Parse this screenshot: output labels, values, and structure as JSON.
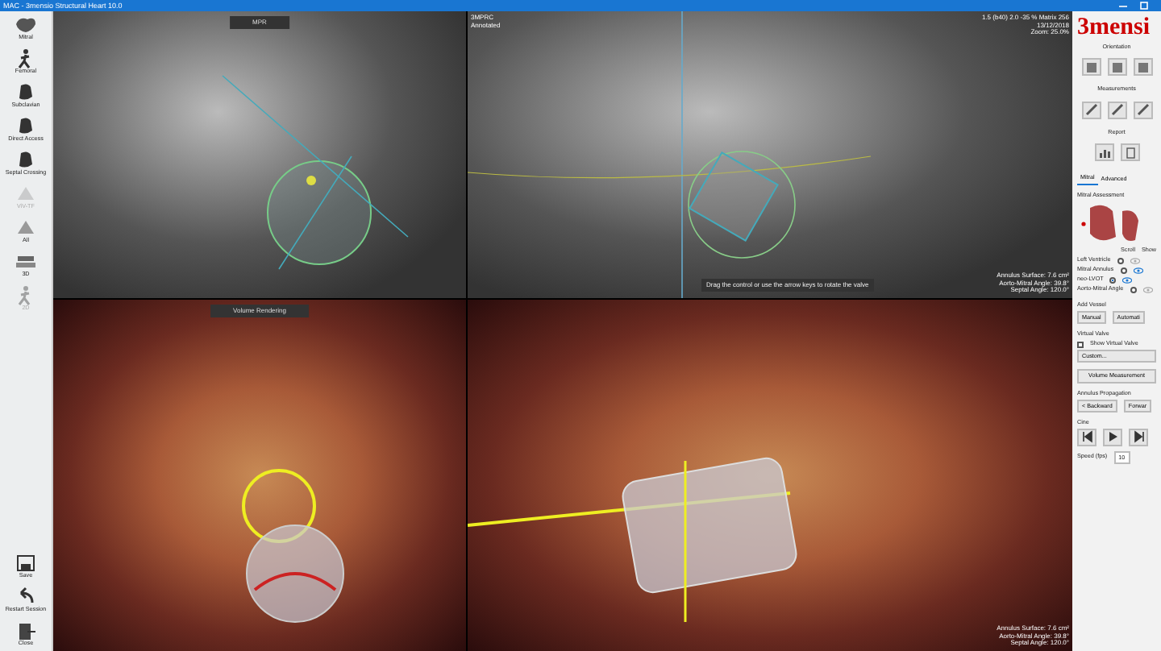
{
  "window": {
    "title": "MAC - 3mensio Structural Heart 10.0"
  },
  "sidebar": {
    "items": [
      {
        "label": "Mitral",
        "kind": "heart",
        "disabled": false
      },
      {
        "label": "Femoral",
        "kind": "walker",
        "disabled": false
      },
      {
        "label": "Subclavian",
        "kind": "torso",
        "disabled": false
      },
      {
        "label": "Direct Access",
        "kind": "torso",
        "disabled": false
      },
      {
        "label": "Septal Crossing",
        "kind": "torso",
        "disabled": false
      },
      {
        "label": "ViV-TF",
        "kind": "valve",
        "disabled": true
      },
      {
        "label": "All",
        "kind": "valve",
        "disabled": false
      },
      {
        "label": "3D",
        "kind": "stack",
        "disabled": false
      },
      {
        "label": "2D",
        "kind": "walker",
        "disabled": true
      }
    ],
    "bottom_items": [
      {
        "label": "Save",
        "kind": "save"
      },
      {
        "label": "Restart Session",
        "kind": "undo"
      },
      {
        "label": "Close",
        "kind": "exit"
      }
    ]
  },
  "viewports": [
    {
      "kind": "ct",
      "header": "MPR"
    },
    {
      "kind": "ct",
      "labels": [
        "3MPRC",
        "Annotated"
      ],
      "info": [
        "1.5 (b40) 2.0 -35 % Matrix 256",
        "13/12/2018",
        "Zoom: 25.0%"
      ],
      "measurements": [
        "Annulus Surface: 7.6 cm²",
        "Aorto-Mitral Angle: 39.8°",
        "Septal Angle: 120.0°"
      ],
      "tooltip": "Drag the control or use the arrow keys to rotate the valve"
    },
    {
      "kind": "volume",
      "header": "Volume Rendering"
    },
    {
      "kind": "volume",
      "measurements": [
        "Annulus Surface: 7.6 cm²",
        "Aorto-Mitral Angle: 39.8°",
        "Septal Angle: 120.0°"
      ]
    }
  ],
  "panel": {
    "logo": "3mensi",
    "sections": [
      {
        "title": "Orientation",
        "tools": [
          {
            "kind": "view"
          },
          {
            "kind": "view"
          },
          {
            "kind": "view"
          }
        ]
      },
      {
        "title": "Measurements",
        "tools": [
          {
            "kind": "ruler"
          },
          {
            "kind": "ruler"
          },
          {
            "kind": "ruler"
          }
        ]
      },
      {
        "title": "Report",
        "tools": [
          {
            "kind": "chart"
          },
          {
            "kind": "page"
          }
        ]
      }
    ],
    "tabs": [
      {
        "label": "Mitral",
        "selected": true
      },
      {
        "label": "Advanced",
        "selected": false
      }
    ],
    "assessment_title": "Mitral Assessment",
    "columns": [
      "Scroll",
      "Show"
    ],
    "rows": [
      {
        "label": "Left Ventricle",
        "selected": false,
        "visible": false
      },
      {
        "label": "Mitral Annulus",
        "selected": false,
        "visible": true
      },
      {
        "label": "neo-LVOT",
        "selected": true,
        "visible": true
      },
      {
        "label": "Aorto-Mitral Angle",
        "selected": false,
        "visible": false
      }
    ],
    "add_vessel": "Add Vessel",
    "vessel_buttons": [
      "Manual",
      "Automati"
    ],
    "virtual_valve": "Virtual Valve",
    "show_valve": {
      "label": "Show Virtual Valve",
      "checked": false
    },
    "valve_select": "Custom...",
    "volume_button": "Volume Measurement",
    "propagation": "Annulus Propagation",
    "propagation_buttons": [
      "< Backward",
      "Forwar"
    ],
    "cine": "Cine",
    "speed_label": "Speed (fps)",
    "speed": "10"
  }
}
